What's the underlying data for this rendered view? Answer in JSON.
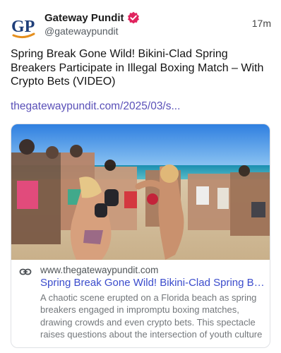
{
  "author": {
    "display_name": "Gateway Pundit",
    "handle": "@gatewaypundit",
    "avatar_text": "GP",
    "verified_icon": "verified-badge-icon",
    "verified_color": "#e0245e"
  },
  "post": {
    "timestamp": "17m",
    "text": "Spring Break Gone Wild! Bikini-Clad Spring Breakers Participate in Illegal Boxing Match – With Crypto Bets (VIDEO)",
    "link_text": "thegatewaypundit.com/2025/03/s..."
  },
  "card": {
    "domain": "www.thegatewaypundit.com",
    "title": "Spring Break Gone Wild! Bikini-Clad Spring Breakers Participate in Illegal Boxing Match",
    "description_lines": [
      "A chaotic scene erupted on a Florida beach as spring",
      "breakers engaged in impromptu boxing matches,",
      "drawing crowds and even crypto bets. This spectacle",
      "raises questions about the intersection of youth culture"
    ],
    "icon": "link-icon"
  },
  "colors": {
    "link": "#5a50b8",
    "card_title": "#3b4ccc",
    "muted": "#73777b"
  }
}
